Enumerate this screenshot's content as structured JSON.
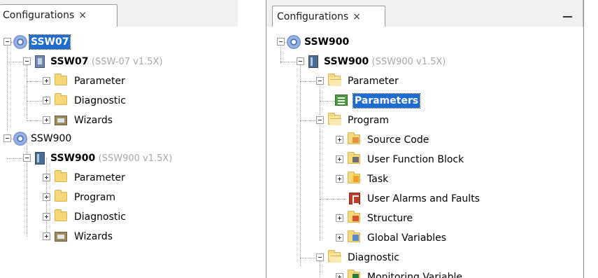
{
  "left_panel": {
    "tab": {
      "label": "Configurations",
      "close": "×"
    },
    "tree": {
      "root1": {
        "label": "SSW07"
      },
      "device1": {
        "name": "SSW07",
        "version": "(SSW-07 v1.5X)"
      },
      "device1_children": [
        "Parameter",
        "Diagnostic",
        "Wizards"
      ],
      "root2": {
        "label": "SSW900"
      },
      "device2": {
        "name": "SSW900",
        "version": "(SSW900 v1.5X)"
      },
      "device2_children": [
        "Parameter",
        "Program",
        "Diagnostic",
        "Wizards"
      ]
    }
  },
  "right_panel": {
    "tab": {
      "label": "Configurations",
      "close": "×"
    },
    "tree": {
      "root": {
        "label": "SSW900"
      },
      "device": {
        "name": "SSW900",
        "version": "(SSW900 v1.5X)"
      },
      "parameter": {
        "label": "Parameter",
        "child": "Parameters"
      },
      "program": {
        "label": "Program",
        "children": [
          "Source Code",
          "User Function Block",
          "Task",
          "User Alarms and Faults",
          "Structure",
          "Global Variables"
        ]
      },
      "diagnostic": {
        "label": "Diagnostic",
        "children": [
          "Monitoring Variable"
        ]
      }
    }
  }
}
